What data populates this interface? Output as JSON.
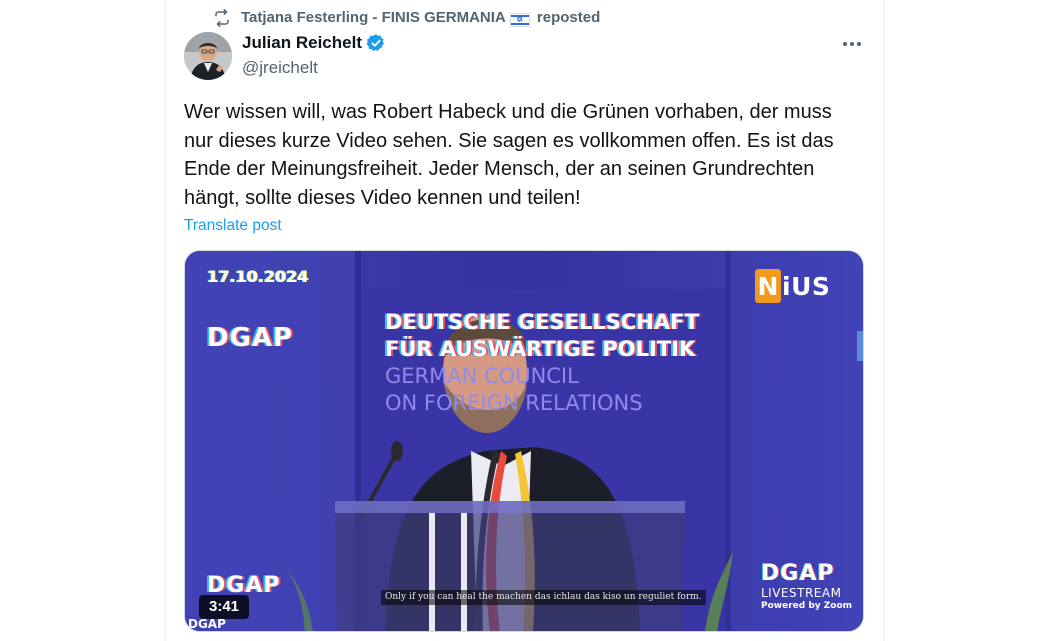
{
  "repost": {
    "icon": "repost-icon",
    "text": "Tatjana Festerling - FINIS GERMANIA",
    "flag": "israel-flag",
    "suffix": "reposted"
  },
  "post": {
    "author_name": "Julian Reichelt",
    "handle": "@jreichelt",
    "verified": true,
    "text": "Wer wissen will, was Robert Habeck und die Grünen vorhaben, der muss\nnur dieses kurze Video sehen. Sie sagen es vollkommen offen. Es ist das\nEnde der Meinungsfreiheit. Jeder Mensch, der an seinen Grundrechten\nhängt, sollte dieses Video kennen und teilen!",
    "translate_label": "Translate post",
    "more_icon": "more-horizontal-icon"
  },
  "video": {
    "date": "17.10.2024",
    "logo_left_top": "DGAP",
    "logo_left_bottom": "DGAP",
    "banner_line1": "DEUTSCHE GESELLSCHAFT",
    "banner_line2": "FÜR AUSWÄRTIGE POLITIK",
    "banner_line3": "GERMAN COUNCIL",
    "banner_line4": "ON FOREIGN RELATIONS",
    "nius_n": "N",
    "nius_rest": "iUS",
    "livestream_logo": "DGAP",
    "livestream_label": "LIVESTREAM",
    "powered_by": "Powered by Zoom",
    "subtitle": "Only if you can heal the machen das ichlau das kiso un reguliet form.",
    "duration": "3:41",
    "corner_logo": "DGAP"
  },
  "colors": {
    "accent": "#1d9bf0",
    "verified": "#1d9bf0",
    "secondary_text": "#536471",
    "nius_orange": "#f29a1d",
    "stage_blue": "#3d3aa8"
  }
}
